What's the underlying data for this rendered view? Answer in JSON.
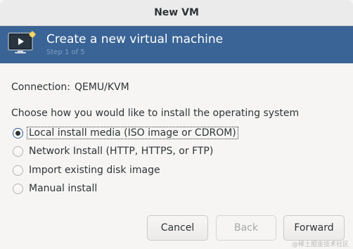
{
  "window": {
    "title": "New VM"
  },
  "banner": {
    "icon": "monitor-play-icon",
    "title": "Create a new virtual machine",
    "step": "Step 1 of 5"
  },
  "connection": {
    "label": "Connection:",
    "value": "QEMU/KVM"
  },
  "install": {
    "question": "Choose how you would like to install the operating system",
    "options": [
      {
        "label": "Local install media (ISO image or CDROM)",
        "selected": true
      },
      {
        "label": "Network Install (HTTP, HTTPS, or FTP)",
        "selected": false
      },
      {
        "label": "Import existing disk image",
        "selected": false
      },
      {
        "label": "Manual install",
        "selected": false
      }
    ]
  },
  "buttons": {
    "cancel": "Cancel",
    "back": "Back",
    "forward": "Forward"
  },
  "watermark": "@稀土掘金技术社区",
  "colors": {
    "banner": "#3a6495",
    "accent": "#2c5b92"
  }
}
